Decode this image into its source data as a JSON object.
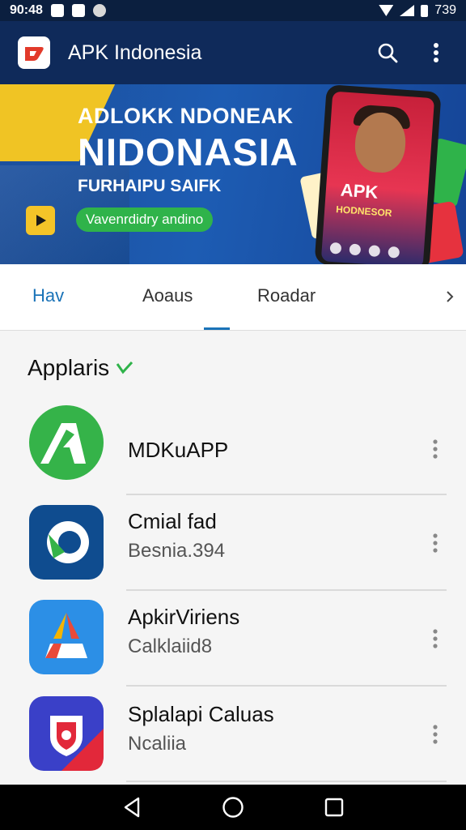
{
  "status_bar": {
    "time": "90:48",
    "right_time": "739"
  },
  "app_bar": {
    "title": "APK Indonesia",
    "icons": [
      "app-logo-icon",
      "search-icon",
      "more-vert-icon"
    ]
  },
  "banner": {
    "line1": "ADLOKK NDONEAK",
    "line2": "NIDONASIA",
    "line3": "FURHAIPU SAIFK",
    "pill": "Vavenrdidry andino",
    "phone_title": "APK",
    "phone_sub": "HODNESOR"
  },
  "tabs": {
    "items": [
      {
        "label": "Hav",
        "active": true
      },
      {
        "label": "Aoaus",
        "active": false
      },
      {
        "label": "Roadar",
        "active": false
      }
    ]
  },
  "section": {
    "title": "Applaris",
    "check_icon": "check-icon"
  },
  "apps": [
    {
      "name": "MDKuAPP",
      "subtitle": "",
      "icon": "green-arrow-icon",
      "color": "#35b349"
    },
    {
      "name": "Cmial fad",
      "subtitle": "Besnia.394",
      "icon": "blue-swirl-icon",
      "color": "#0f4c8f"
    },
    {
      "name": "ApkirViriens",
      "subtitle": "Calklaiid8",
      "icon": "multicolor-a-icon",
      "color": "#2c8fe6"
    },
    {
      "name": "Splalapi Caluas",
      "subtitle": "Ncaliia",
      "icon": "shield-icon",
      "color": "#3a40c8"
    }
  ],
  "nav_bar": {
    "icons": [
      "back-icon",
      "home-icon",
      "recents-icon"
    ]
  }
}
